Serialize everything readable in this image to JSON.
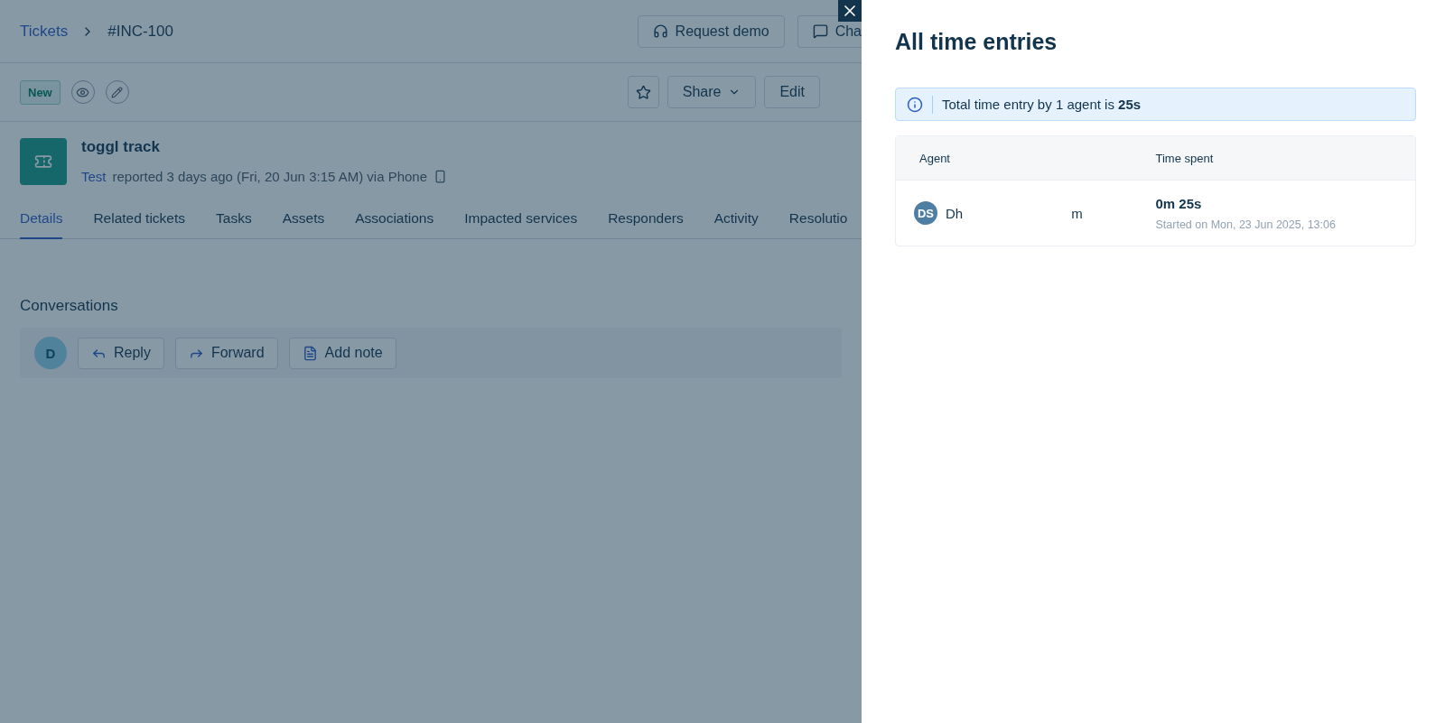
{
  "breadcrumb": {
    "parent": "Tickets",
    "current": "#INC-100"
  },
  "header_buttons": [
    {
      "label": "Request demo",
      "kind": "headset"
    },
    {
      "label": "Cha",
      "kind": "chat"
    }
  ],
  "status_badge": "New",
  "toolbar_buttons": [
    {
      "label": "Share",
      "kind": "dropdown"
    },
    {
      "label": "Edit",
      "kind": "plain"
    }
  ],
  "ticket": {
    "title": "toggl track",
    "requester": "Test",
    "meta": "reported 3 days ago (Fri, 20 Jun 3:15 AM) via Phone"
  },
  "tabs": [
    {
      "label": "Details",
      "selected": true
    },
    {
      "label": "Related tickets",
      "selected": false
    },
    {
      "label": "Tasks",
      "selected": false
    },
    {
      "label": "Assets",
      "selected": false
    },
    {
      "label": "Associations",
      "selected": false
    },
    {
      "label": "Impacted services",
      "selected": false
    },
    {
      "label": "Responders",
      "selected": false
    },
    {
      "label": "Activity",
      "selected": false
    },
    {
      "label": "Resolutio",
      "selected": false
    }
  ],
  "conversations": {
    "title": "Conversations",
    "avatar": "D",
    "actions": [
      {
        "label": "Reply",
        "kind": "reply"
      },
      {
        "label": "Forward",
        "kind": "forward"
      },
      {
        "label": "Add note",
        "kind": "note"
      }
    ]
  },
  "drawer": {
    "title": "All time entries",
    "summary": "Total time entry by 1 agent is **25s**",
    "columns": [
      "Agent",
      "Time spent"
    ],
    "rows": [
      {
        "initials": "DS",
        "name_start": "Dh",
        "name_end": "m",
        "time": "0m 25s",
        "started": "Started on Mon, 23 Jun 2025, 13:06"
      }
    ]
  }
}
